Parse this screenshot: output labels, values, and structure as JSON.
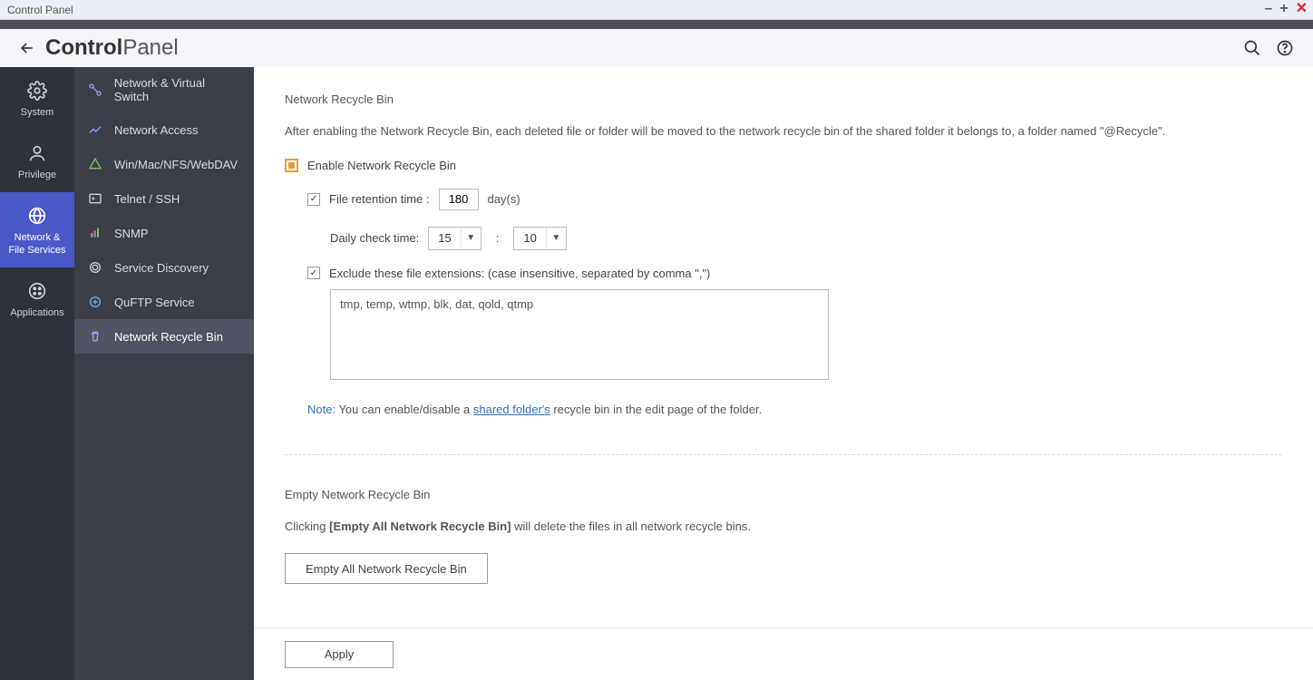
{
  "window": {
    "title": "Control Panel"
  },
  "header": {
    "brand_bold": "Control",
    "brand_light": "Panel"
  },
  "rail": {
    "items": [
      {
        "label": "System",
        "icon": "gear-icon"
      },
      {
        "label": "Privilege",
        "icon": "user-icon"
      },
      {
        "label": "Network &\nFile Services",
        "icon": "globe-icon"
      },
      {
        "label": "Applications",
        "icon": "apps-icon"
      }
    ]
  },
  "subnav": {
    "items": [
      {
        "label": "Network & Virtual Switch"
      },
      {
        "label": "Network Access"
      },
      {
        "label": "Win/Mac/NFS/WebDAV"
      },
      {
        "label": "Telnet / SSH"
      },
      {
        "label": "SNMP"
      },
      {
        "label": "Service Discovery"
      },
      {
        "label": "QuFTP Service"
      },
      {
        "label": "Network Recycle Bin"
      }
    ]
  },
  "main": {
    "section1_title": "Network Recycle Bin",
    "section1_desc": "After enabling the Network Recycle Bin, each deleted file or folder will be moved to the network recycle bin of the shared folder it belongs to, a folder named \"@Recycle\".",
    "enable_label": "Enable Network Recycle Bin",
    "retention_label": "File retention time :",
    "retention_value": "180",
    "retention_unit": "day(s)",
    "check_label": "Daily check time:",
    "check_hour": "15",
    "check_minute": "10",
    "exclude_label": "Exclude these file extensions: (case insensitive, separated by comma \",\")",
    "exclude_value": "tmp, temp, wtmp, blk, dat, qold, qtmp",
    "note_tag": "Note:",
    "note_before": " You can enable/disable a ",
    "note_link": "shared folder's",
    "note_after": " recycle bin in the edit page of the folder.",
    "section2_title": "Empty Network Recycle Bin",
    "section2_before": "Clicking ",
    "section2_bold": "[Empty All Network Recycle Bin]",
    "section2_after": " will delete the files in all network recycle bins.",
    "empty_btn": "Empty All Network Recycle Bin",
    "apply_btn": "Apply"
  }
}
